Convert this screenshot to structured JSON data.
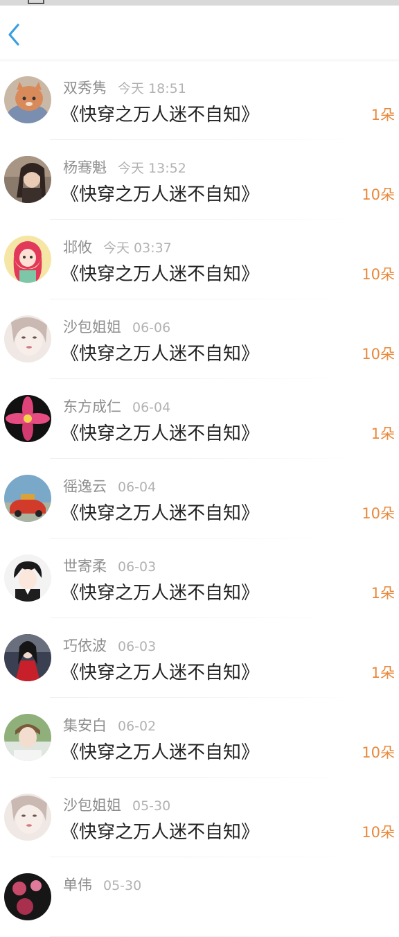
{
  "colors": {
    "accent_blue": "#3a9fe0",
    "count_orange": "#e8883a",
    "title_text": "#222222",
    "meta_text": "#8e8e8e"
  },
  "nav": {
    "back_icon": "chevron-left-icon"
  },
  "items": [
    {
      "name": "双秀隽",
      "date": "今天 18:51",
      "title": "《快穿之万人迷不自知》",
      "count": "1朵",
      "avatar": "cat"
    },
    {
      "name": "杨骞魁",
      "date": "今天 13:52",
      "title": "《快穿之万人迷不自知》",
      "count": "10朵",
      "avatar": "woman-brown"
    },
    {
      "name": "邶攸",
      "date": "今天 03:37",
      "title": "《快穿之万人迷不自知》",
      "count": "10朵",
      "avatar": "cartoon-girl"
    },
    {
      "name": "沙包姐姐",
      "date": "06-06",
      "title": "《快穿之万人迷不自知》",
      "count": "10朵",
      "avatar": "portrait-pale"
    },
    {
      "name": "东方成仁",
      "date": "06-04",
      "title": "《快穿之万人迷不自知》",
      "count": "1朵",
      "avatar": "pink-flower"
    },
    {
      "name": "徭逸云",
      "date": "06-04",
      "title": "《快穿之万人迷不自知》",
      "count": "10朵",
      "avatar": "red-car"
    },
    {
      "name": "世寄柔",
      "date": "06-03",
      "title": "《快穿之万人迷不自知》",
      "count": "1朵",
      "avatar": "anime-boy"
    },
    {
      "name": "巧依波",
      "date": "06-03",
      "title": "《快穿之万人迷不自知》",
      "count": "1朵",
      "avatar": "woman-red-dress"
    },
    {
      "name": "集安白",
      "date": "06-02",
      "title": "《快穿之万人迷不自知》",
      "count": "10朵",
      "avatar": "young-man"
    },
    {
      "name": "沙包姐姐",
      "date": "05-30",
      "title": "《快穿之万人迷不自知》",
      "count": "10朵",
      "avatar": "portrait-pale"
    },
    {
      "name": "单伟",
      "date": "05-30",
      "title": "",
      "count": "",
      "avatar": "dark-floral"
    }
  ]
}
